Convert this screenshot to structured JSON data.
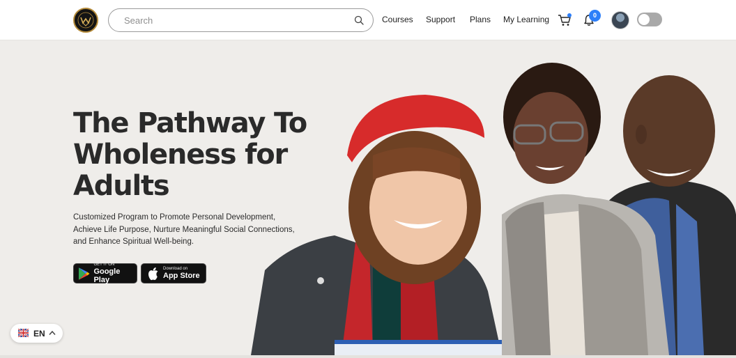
{
  "header": {
    "logo_name": "logo-icon",
    "search": {
      "placeholder": "Search",
      "value": ""
    },
    "nav": [
      {
        "label": "Courses"
      },
      {
        "label": "Support"
      },
      {
        "label": "Plans"
      },
      {
        "label": "My Learning"
      }
    ],
    "notifications_count": "0",
    "colors": {
      "accent": "#2d7ff9",
      "toggle": "#a9a9a9"
    }
  },
  "hero": {
    "title": "The Pathway To Wholeness for Adults",
    "subtitle": "Customized Program to Promote Personal Development, Achieve Life Purpose, Nurture Meaningful Social Connections, and Enhance Spiritual Well-being.",
    "google_play": {
      "small": "GET IT ON",
      "big": "Google Play"
    },
    "app_store": {
      "small": "Download on",
      "big": "App Store"
    }
  },
  "language": {
    "code": "EN",
    "flag": "uk-flag-icon"
  }
}
